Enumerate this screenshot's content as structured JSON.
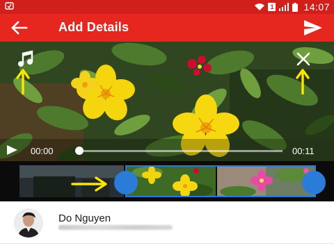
{
  "status_bar": {
    "sim_badge": "1",
    "time": "14:07",
    "icons": [
      "notification-icon",
      "wifi-icon",
      "sim-icon",
      "signal-icon",
      "battery-icon"
    ]
  },
  "app_bar": {
    "title": "Add Details",
    "back_icon": "arrow-back-icon",
    "send_icon": "send-icon",
    "color": "#e5271f"
  },
  "video": {
    "current_time": "00:00",
    "end_time": "00:11",
    "playback_progress": 0.0,
    "overlay_icons": [
      "music-note-icon",
      "close-icon",
      "play-icon"
    ]
  },
  "timeline": {
    "selection_color": "#2b7bd9",
    "annotation_color": "#ffe600"
  },
  "user": {
    "name": "Do Nguyen"
  }
}
